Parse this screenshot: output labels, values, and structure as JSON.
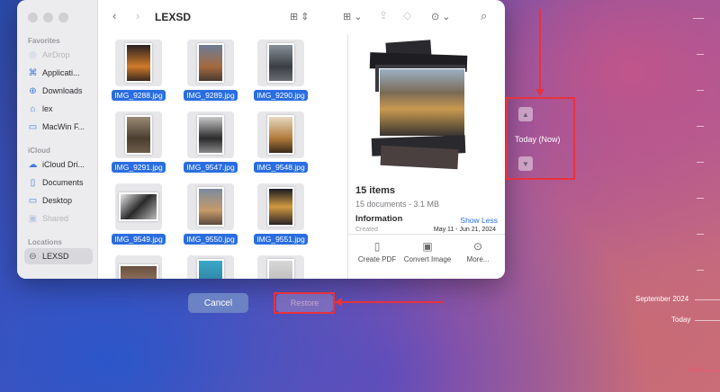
{
  "sidebar": {
    "favorites_label": "Favorites",
    "favorites": [
      {
        "label": "AirDrop",
        "icon": "airdrop-icon",
        "dim": true
      },
      {
        "label": "Applicati...",
        "icon": "applications-icon"
      },
      {
        "label": "Downloads",
        "icon": "downloads-icon"
      },
      {
        "label": "lex",
        "icon": "home-icon"
      },
      {
        "label": "MacWin F...",
        "icon": "folder-icon"
      }
    ],
    "icloud_label": "iCloud",
    "icloud": [
      {
        "label": "iCloud Dri...",
        "icon": "cloud-icon"
      },
      {
        "label": "Documents",
        "icon": "document-icon"
      },
      {
        "label": "Desktop",
        "icon": "desktop-icon"
      },
      {
        "label": "Shared",
        "icon": "shared-folder-icon",
        "dim": true
      }
    ],
    "locations_label": "Locations",
    "locations": [
      {
        "label": "LEXSD",
        "icon": "drive-icon",
        "selected": true
      }
    ]
  },
  "toolbar": {
    "title": "LEXSD"
  },
  "files": [
    {
      "name": "IMG_9288.jpg"
    },
    {
      "name": "IMG_9289.jpg"
    },
    {
      "name": "IMG_9290.jpg"
    },
    {
      "name": "IMG_9291.jpg"
    },
    {
      "name": "IMG_9547.jpg"
    },
    {
      "name": "IMG_9548.jpg"
    },
    {
      "name": "IMG_9549.jpg"
    },
    {
      "name": "IMG_9550.jpg"
    },
    {
      "name": "IMG_9551.jpg"
    },
    {
      "name": ""
    },
    {
      "name": ""
    },
    {
      "name": ""
    }
  ],
  "preview": {
    "count": "15 items",
    "subtitle": "15 documents - 3.1 MB",
    "info_heading": "Information",
    "show_less": "Show Less",
    "created_label": "Created",
    "created_value": "May 11 - Jun 21, 2024",
    "actions": [
      {
        "label": "Create PDF",
        "icon": "pdf-icon"
      },
      {
        "label": "Convert Image",
        "icon": "convert-image-icon"
      },
      {
        "label": "More...",
        "icon": "more-icon"
      }
    ]
  },
  "buttons": {
    "cancel": "Cancel",
    "restore": "Restore"
  },
  "time_machine": {
    "current": "Today (Now)",
    "timeline": [
      "September 2024",
      "Today",
      "Now"
    ]
  },
  "colors": {
    "accent": "#2a6de0",
    "highlight": "#e8323c"
  }
}
